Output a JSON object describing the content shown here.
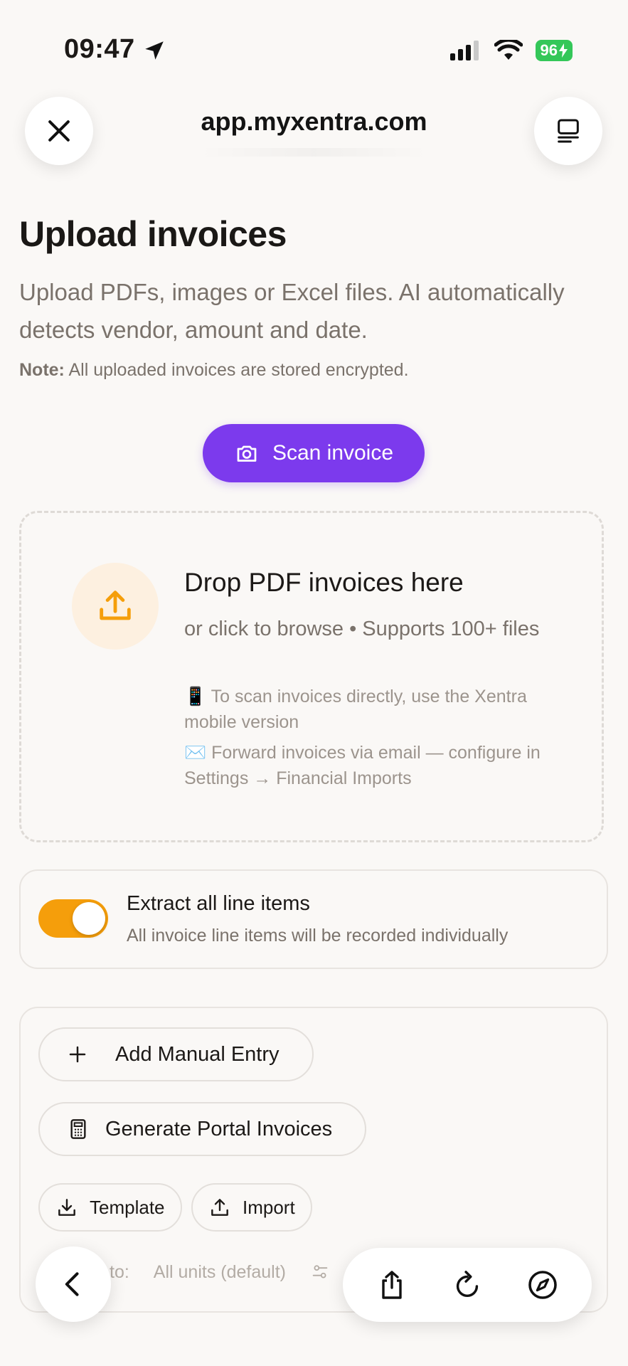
{
  "status_bar": {
    "time": "09:47",
    "battery": "96"
  },
  "browser": {
    "url": "app.myxentra.com"
  },
  "page": {
    "title": "Upload invoices",
    "description": "Upload PDFs, images or Excel files. AI automatically detects vendor, amount and date.",
    "note_label": "Note:",
    "note_text": "All uploaded invoices are stored encrypted.",
    "scan_button": "Scan invoice"
  },
  "dropzone": {
    "title": "Drop PDF invoices here",
    "subtitle": "or click to browse • Supports 100+ files",
    "hint_mobile_emoji": "📱",
    "hint_mobile": "To scan invoices directly, use the Xentra mobile version",
    "hint_email_emoji": "✉️",
    "hint_email": "Forward invoices via email — configure in Settings → Financial Imports"
  },
  "line_items": {
    "enabled": true,
    "title": "Extract all line items",
    "subtitle": "All invoice line items will be recorded individually"
  },
  "actions": {
    "add_manual": "Add Manual Entry",
    "generate_portal": "Generate Portal Invoices",
    "template": "Template",
    "import": "Import",
    "apply_label": "to:",
    "apply_value": "All units (default)"
  },
  "colors": {
    "accent_purple": "#7c3aed",
    "accent_orange": "#f59e0b",
    "battery_green": "#34c759"
  }
}
